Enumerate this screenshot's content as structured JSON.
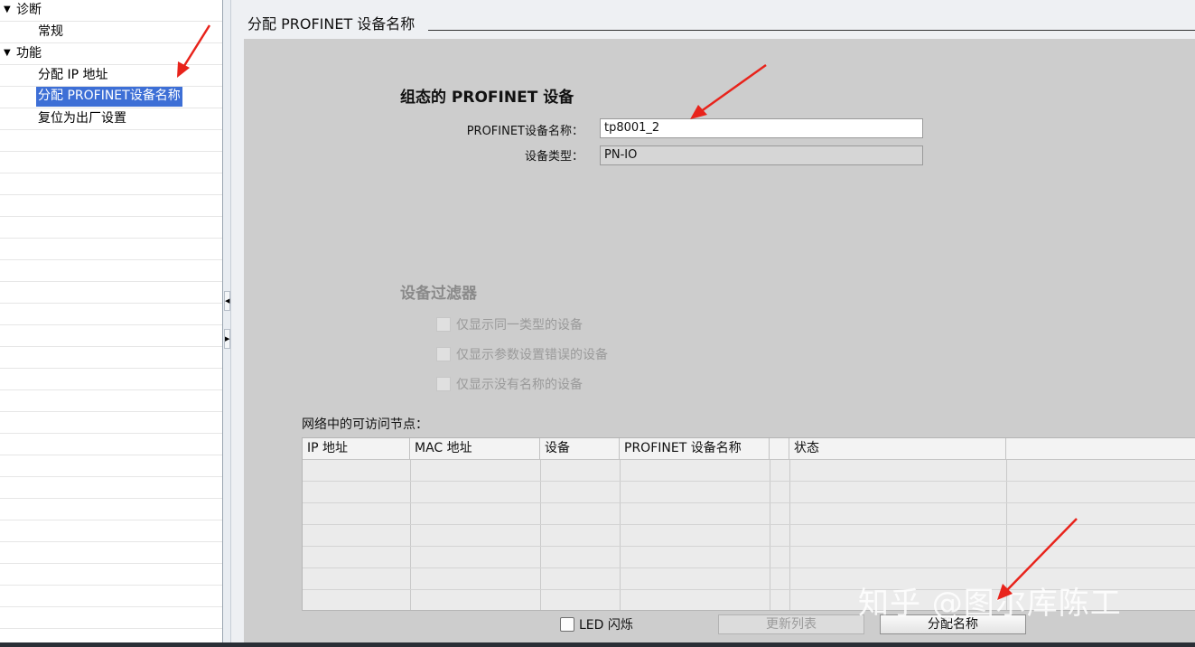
{
  "tree": {
    "items": [
      {
        "label": "诊断",
        "expanded": true
      },
      {
        "label": "常规"
      },
      {
        "label": "功能",
        "expanded": true
      },
      {
        "label": "分配 IP 地址"
      },
      {
        "label": "分配 PROFINET设备名称",
        "selected": true
      },
      {
        "label": "复位为出厂设置"
      }
    ]
  },
  "header": {
    "title": "分配 PROFINET 设备名称"
  },
  "config": {
    "title": "组态的 PROFINET 设备",
    "name_label": "PROFINET设备名称：",
    "name_value": "tp8001_2",
    "type_label": "设备类型：",
    "type_value": "PN-IO"
  },
  "filter": {
    "title": "设备过滤器",
    "options": [
      "仅显示同一类型的设备",
      "仅显示参数设置错误的设备",
      "仅显示没有名称的设备"
    ]
  },
  "nodes": {
    "label": "网络中的可访问节点：",
    "columns": [
      "IP 地址",
      "MAC 地址",
      "设备",
      "PROFINET 设备名称",
      "",
      "状态",
      ""
    ],
    "rows": []
  },
  "actions": {
    "led_label": "LED 闪烁",
    "refresh_label": "更新列表",
    "assign_label": "分配名称"
  },
  "watermark": "知乎 @图尔库陈工",
  "colors": {
    "selection": "#3d6fd6",
    "annotation_arrow": "#e8231b",
    "content_bg": "#cdcdcd"
  }
}
